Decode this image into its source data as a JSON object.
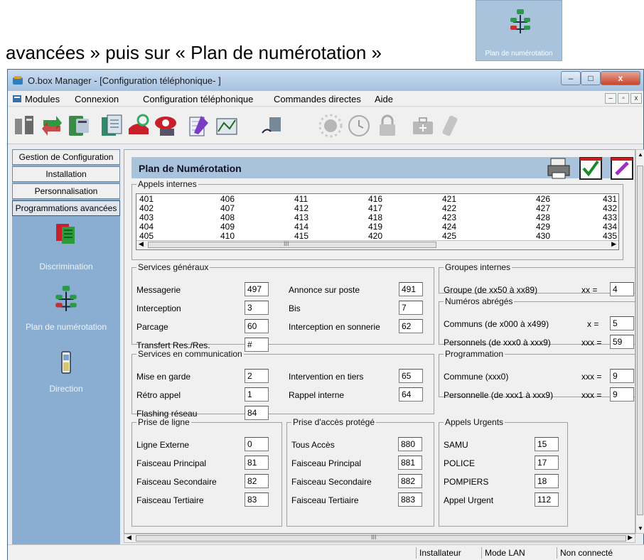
{
  "caption": {
    "text": "avancées » puis sur « Plan de numérotation »",
    "thumb_label": "Plan de numérotation"
  },
  "window": {
    "title": "O.box Manager - [Configuration téléphonique- ]",
    "controls": {
      "minimize": "–",
      "maximize": "□",
      "close": "x"
    }
  },
  "menu": {
    "items": [
      "Modules",
      "Connexion",
      "Configuration téléphonique",
      "Commandes directes",
      "Aide"
    ],
    "mdi": {
      "minimize": "–",
      "restore": "▫",
      "close": "x"
    }
  },
  "sidebar": {
    "nav": [
      "Gestion de Configuration",
      "Installation",
      "Personnalisation",
      "Programmations avancées"
    ],
    "items": [
      "Discrimination",
      "Plan de numérotation",
      "Direction"
    ]
  },
  "page": {
    "title": "Plan de Numérotation"
  },
  "appels_internes": {
    "legend": "Appels internes",
    "columns": [
      [
        "401",
        "402",
        "403",
        "404",
        "405"
      ],
      [
        "406",
        "407",
        "408",
        "409",
        "410"
      ],
      [
        "411",
        "412",
        "413",
        "414",
        "415"
      ],
      [
        "416",
        "417",
        "418",
        "419",
        "420"
      ],
      [
        "421",
        "422",
        "423",
        "424",
        "425"
      ],
      [
        "426",
        "427",
        "428",
        "429",
        "430"
      ],
      [
        "431",
        "432",
        "433",
        "434",
        "435"
      ]
    ]
  },
  "services_generaux": {
    "legend": "Services généraux",
    "rows": [
      {
        "label": "Messagerie",
        "value": "497"
      },
      {
        "label": "Interception",
        "value": "3"
      },
      {
        "label": "Parcage",
        "value": "60"
      },
      {
        "label": "Transfert Res./Res.",
        "value": "#"
      },
      {
        "label": "Annonce sur poste",
        "value": "491"
      },
      {
        "label": "Bis",
        "value": "7"
      },
      {
        "label": "Interception en sonnerie",
        "value": "62"
      }
    ]
  },
  "groupes_internes": {
    "legend": "Groupes internes",
    "label": "Groupe (de xx50 à xx89)",
    "prefix": "xx =",
    "value": "4"
  },
  "numeros_abreges": {
    "legend": "Numéros abrégés",
    "rows": [
      {
        "label": "Communs (de x000 à x499)",
        "prefix": "x =",
        "value": "5"
      },
      {
        "label": "Personnels (de xxx0 à xxx9)",
        "prefix": "xxx =",
        "value": "59"
      }
    ]
  },
  "services_communication": {
    "legend": "Services en communication",
    "rows": [
      {
        "label": "Mise en garde",
        "value": "2"
      },
      {
        "label": "Rétro appel",
        "value": "1"
      },
      {
        "label": "Flashing réseau",
        "value": "84"
      },
      {
        "label": "Intervention en tiers",
        "value": "65"
      },
      {
        "label": "Rappel interne",
        "value": "64"
      }
    ]
  },
  "programmation": {
    "legend": "Programmation",
    "rows": [
      {
        "label": "Commune  (xxx0)",
        "prefix": "xxx =",
        "value": "9"
      },
      {
        "label": "Personnelle  (de xxx1 à xxx9)",
        "prefix": "xxx =",
        "value": "9"
      }
    ]
  },
  "prise_de_ligne": {
    "legend": "Prise de ligne",
    "rows": [
      {
        "label": "Ligne Externe",
        "value": "0"
      },
      {
        "label": "Faisceau Principal",
        "value": "81"
      },
      {
        "label": "Faisceau Secondaire",
        "value": "82"
      },
      {
        "label": "Faisceau  Tertiaire",
        "value": "83"
      }
    ]
  },
  "prise_acces_protege": {
    "legend": "Prise d'accès protégé",
    "rows": [
      {
        "label": "Tous Accès",
        "value": "880"
      },
      {
        "label": "Faisceau Principal",
        "value": "881"
      },
      {
        "label": "Faisceau Secondaire",
        "value": "882"
      },
      {
        "label": "Faisceau Tertiaire",
        "value": "883"
      }
    ]
  },
  "appels_urgents": {
    "legend": "Appels Urgents",
    "rows": [
      {
        "label": "SAMU",
        "value": "15"
      },
      {
        "label": "POLICE",
        "value": "17"
      },
      {
        "label": "POMPIERS",
        "value": "18"
      },
      {
        "label": "Appel Urgent",
        "value": "112"
      }
    ]
  },
  "status": {
    "user": "Installateur",
    "mode": "Mode LAN",
    "connection": "Non connecté"
  },
  "scroll": {
    "thumb_glyph": "III"
  },
  "colors": {
    "header_band": "#a9c3dd",
    "sidebar": "#8aaed2",
    "title_gradient_top": "#c9dcf0"
  }
}
